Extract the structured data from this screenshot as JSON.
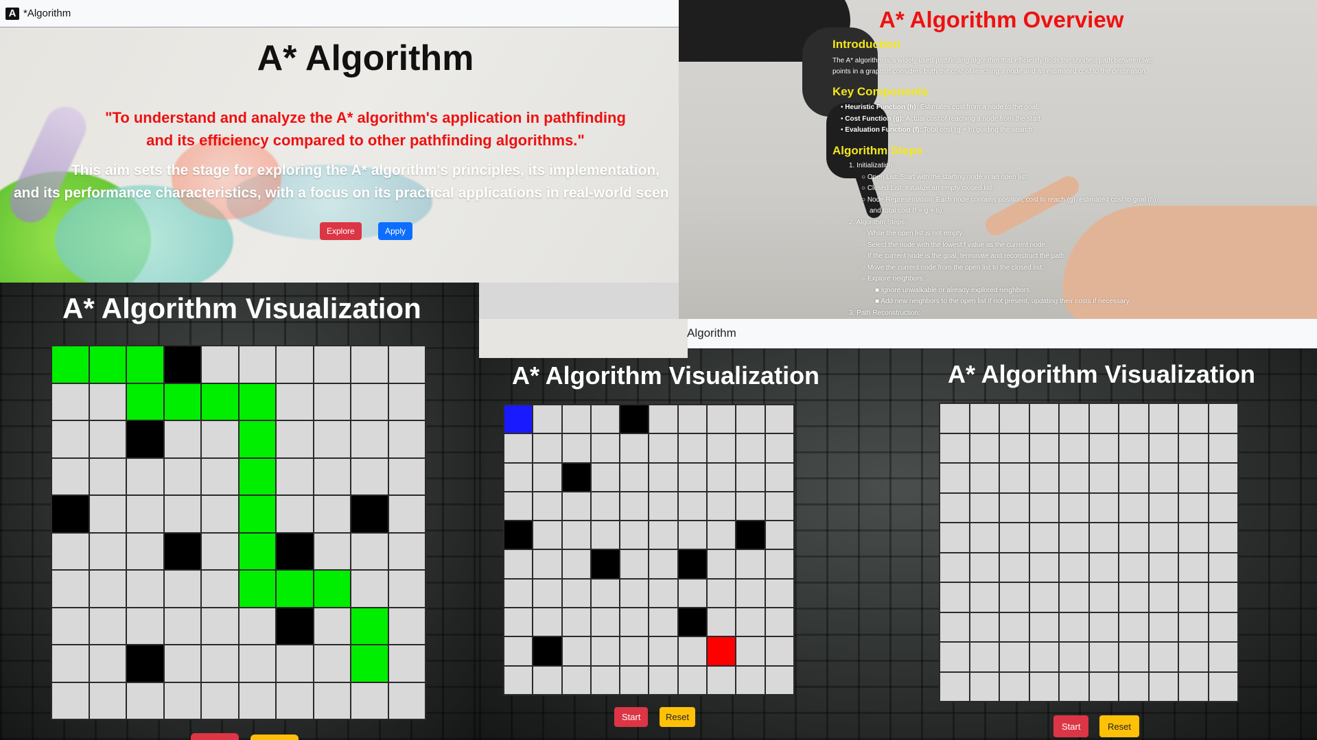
{
  "top_left": {
    "nav_title": "*Algorithm",
    "logo": "A",
    "heading": "A* Algorithm",
    "quote_line1": "\"To understand and analyze the A* algorithm's application in pathfinding",
    "quote_line2": "and its efficiency compared to other pathfinding algorithms.\"",
    "aim_line1": "This aim sets the stage for exploring the A* algorithm's principles, its implementation,",
    "aim_line2": "and its performance characteristics, with a focus on its practical applications in real-world scen",
    "explore_label": "Explore",
    "apply_label": "Apply"
  },
  "overview": {
    "title": "A* Algorithm Overview",
    "intro_heading": "Introduction",
    "intro_line1": "The A* algorithm is a widely used pathfinding algorithm that efficiently finds the shortest path between two",
    "intro_line2": "points in a graph. It considers both the cost of reaching a node and an estimated cost to the destination.",
    "key_heading": "Key Components",
    "key_items": [
      {
        "term": "Heuristic Function (h):",
        "desc": " Estimates cost from a node to the goal."
      },
      {
        "term": "Cost Function (g):",
        "desc": " Actual cost of reaching a node from the start."
      },
      {
        "term": "Evaluation Function (f):",
        "desc": " Total cost (g + h) guiding the search."
      }
    ],
    "steps_heading": "Algorithm Steps",
    "steps": [
      "1. Initialization:",
      "Open List: Start with the starting node in an open list.",
      "Closed List: Initialize an empty closed list.",
      "Node Representation: Each node contains position, cost to reach (g), estimated cost to goal (h),",
      "and total cost (f = g + h).",
      "2. Algorithm Steps:",
      "While the open list is not empty:",
      "Select the node with the lowest f value as the current node.",
      "If the current node is the goal, terminate and reconstruct the path.",
      "Move the current node from the open list to the closed list.",
      "Explore neighbors:",
      "Ignore unwalkable or already explored neighbors.",
      "Add new neighbors to the open list if not present, updating their costs if necessary.",
      "3. Path Reconstruction:"
    ]
  },
  "viz_left": {
    "title": "A* Algorithm Visualization",
    "grid": [
      "PPPW......",
      "..PPPP....",
      "..W..P....",
      ".....P....",
      "W....P..W.",
      "...W.PW...",
      ".....PPP..",
      "......W.P.",
      "..W.....P.",
      ".........."
    ]
  },
  "viz_mid": {
    "nav_title": "Algorithm",
    "title": "A* Algorithm Visualization",
    "grid": [
      "S...W.....",
      "..........",
      "..W.......",
      "..........",
      "W.......W.",
      "...W..W...",
      "..........",
      "......W...",
      ".W.....E..",
      ".........."
    ],
    "start_label": "Start",
    "reset_label": "Reset"
  },
  "viz_right": {
    "title": "A* Algorithm Visualization",
    "grid": [
      "..........",
      "..........",
      "..........",
      "..........",
      "..........",
      "..........",
      "..........",
      "..........",
      "..........",
      ".........."
    ],
    "start_label": "Start",
    "reset_label": "Reset"
  },
  "colors": {
    "wall": "#000000",
    "path": "#00ee00",
    "start": "#1a1aff",
    "end": "#ff0000",
    "empty": "#d9d9d9",
    "title_red": "#ee1111",
    "heading_yellow": "#f4e81a"
  }
}
